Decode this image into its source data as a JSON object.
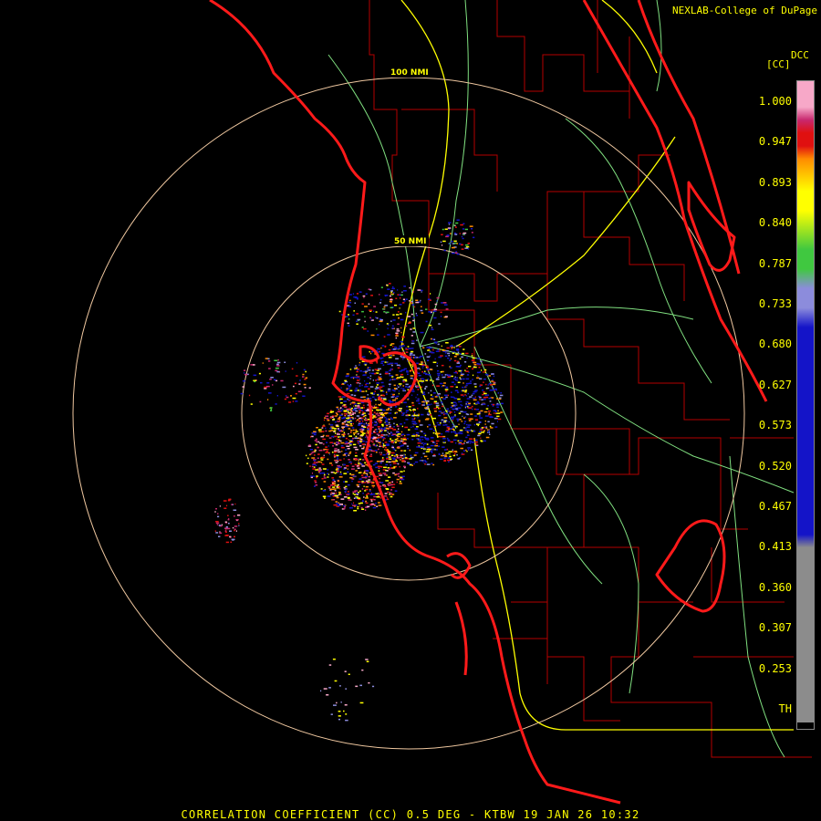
{
  "credit": "NEXLAB-College of DuPage",
  "radar_title": "CORRELATION COEFFICIENT (CC) 0.5 DEG - KTBW 19 JAN 26 10:32",
  "legend": {
    "product_code": "DCC",
    "unit": "[CC]",
    "labels": [
      "1.000",
      "0.947",
      "0.893",
      "0.840",
      "0.787",
      "0.733",
      "0.680",
      "0.627",
      "0.573",
      "0.520",
      "0.467",
      "0.413",
      "0.360",
      "0.307",
      "0.253",
      "TH"
    ],
    "colors": {
      "pink": "#f7a8c8",
      "magenta": "#c8286e",
      "red": "#e01010",
      "orange": "#ff8c00",
      "yellow": "#ffff00",
      "green": "#40c840",
      "lavender": "#8c8cdc",
      "blue": "#1414c8",
      "gray": "#8c8c8c",
      "black": "#000000"
    }
  },
  "range_rings": [
    "100 NMI",
    "50 NMI"
  ],
  "map_colors": {
    "coast": "#ff1a1a",
    "county": "#b40000",
    "highway": "#ffff00",
    "road": "#80e080",
    "ring": "#f0c8a0"
  }
}
